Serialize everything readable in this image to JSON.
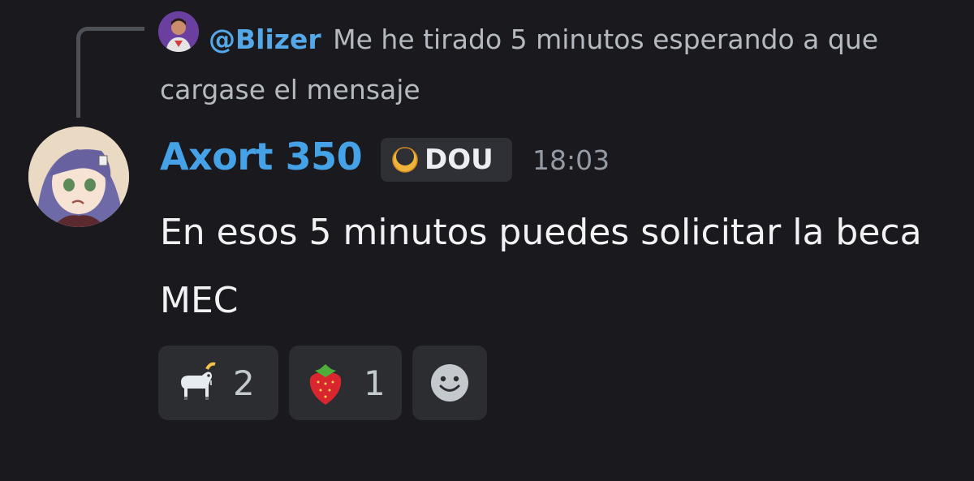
{
  "reply": {
    "author": "@Blizer",
    "text": "Me he tirado 5 minutos esperando a que cargase el mensaje"
  },
  "message": {
    "author": "Axort 350",
    "tag": "DOU",
    "timestamp": "18:03",
    "text": "En esos 5 minutos puedes solicitar la beca MEC"
  },
  "reactions": [
    {
      "emoji": "goat-icon",
      "count": "2"
    },
    {
      "emoji": "strawberry-icon",
      "count": "1"
    }
  ],
  "add_reaction": {
    "icon": "smiley-icon"
  },
  "colors": {
    "background": "#1a1a1e",
    "author": "#45a2e6",
    "reply_author": "#55a8e8",
    "reaction_bg": "#2b2d31"
  }
}
